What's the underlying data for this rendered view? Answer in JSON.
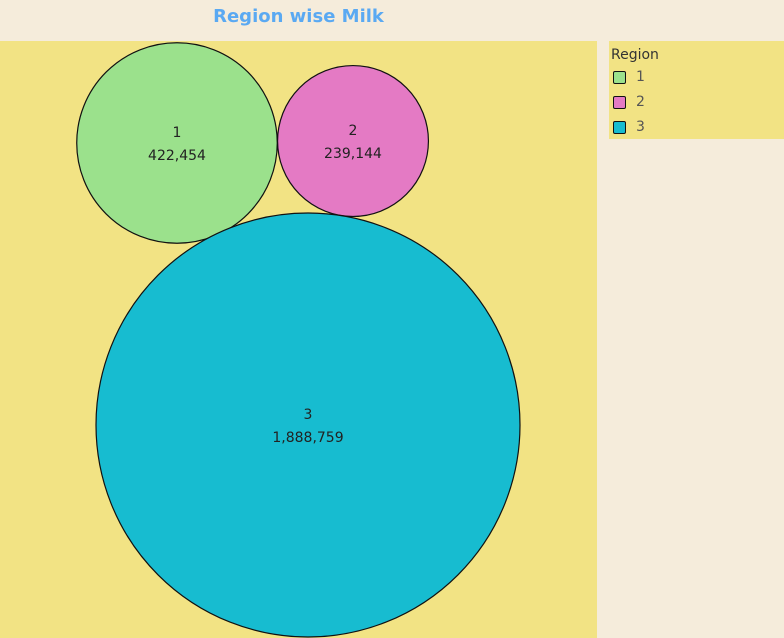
{
  "chart_data": {
    "type": "bubble",
    "title": "Region wise Milk",
    "legend_title": "Region",
    "legend_position": "top-right",
    "series": [
      {
        "label": "1",
        "value": 422454,
        "value_label": "422,454",
        "color": "#9be18c"
      },
      {
        "label": "2",
        "value": 239144,
        "value_label": "239,144",
        "color": "#e47ac4"
      },
      {
        "label": "3",
        "value": 1888759,
        "value_label": "1,888,759",
        "color": "#17bcd0"
      }
    ]
  },
  "colors": {
    "page_background": "#f5ecdb",
    "plot_background": "#f2e384",
    "title_color": "#5aa9f2"
  }
}
